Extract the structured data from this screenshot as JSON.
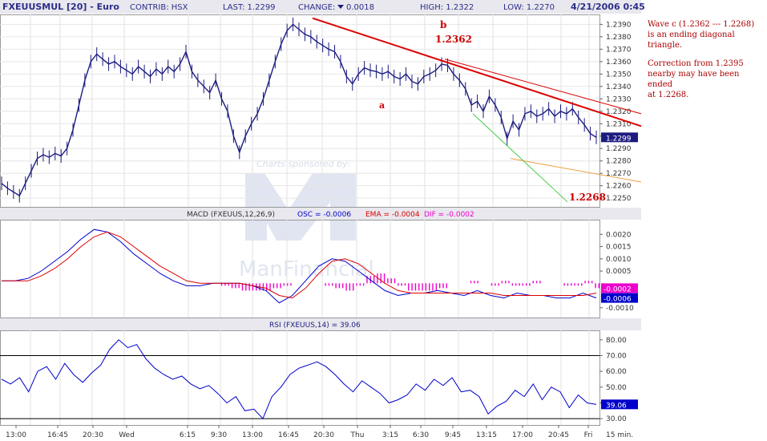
{
  "header": {
    "symbol": "FXEUUSMUL [20] - Euro",
    "contrib": "CONTRIB: HSX",
    "last": "LAST: 1.2299",
    "change_label": "CHANGE:",
    "change_value": "0.0018",
    "high": "HIGH: 1.2322",
    "low": "LOW: 1.2270",
    "datetime": "4/21/2006 0:45"
  },
  "watermark": {
    "sponsor": "Charts sponsored by:",
    "brand": "ManFinancial"
  },
  "colors": {
    "price": "#1c1c80",
    "trendline": "#dd0000",
    "channel_orange": "#f0a040",
    "channel_green": "#44cc44",
    "macd": "#0000cc",
    "signal": "#dd0000",
    "histogram": "#ee00cc",
    "rsi": "#0000cc",
    "header_bg": "#e8e8ee",
    "panel_header_bg": "#e8e8ee"
  },
  "chart_data": [
    {
      "type": "line",
      "title": "FXEUUSMUL [20] - Euro",
      "ylim": [
        1.2243,
        1.2398
      ],
      "ytick_labels": [
        "1.2390",
        "1.2380",
        "1.2370",
        "1.2360",
        "1.2350",
        "1.2340",
        "1.2330",
        "1.2320",
        "1.2310",
        "1.2300",
        "1.2290",
        "1.2280",
        "1.2270",
        "1.2260",
        "1.2250"
      ],
      "yticks": [
        1.239,
        1.238,
        1.237,
        1.236,
        1.235,
        1.234,
        1.233,
        1.232,
        1.231,
        1.23,
        1.229,
        1.228,
        1.227,
        1.226,
        1.225
      ],
      "last_value_label": "1.2299",
      "last_value": 1.2299,
      "xtick_labels": [
        "13:00",
        "16:45",
        "20:30",
        "Wed",
        "6:15",
        "9:30",
        "13:00",
        "16:45",
        "20:30",
        "Thu",
        "3:15",
        "6:30",
        "9:45",
        "13:15",
        "17:00",
        "20:45",
        "Fri"
      ],
      "xaxis_unit": "15 min.",
      "series": [
        {
          "values": [
            1.2262,
            1.2258,
            1.2255,
            1.2252,
            1.2262,
            1.2272,
            1.2282,
            1.2285,
            1.2283,
            1.2286,
            1.2284,
            1.229,
            1.2305,
            1.2325,
            1.2345,
            1.236,
            1.2366,
            1.2362,
            1.2358,
            1.236,
            1.2356,
            1.2353,
            1.235,
            1.2356,
            1.2352,
            1.2348,
            1.2354,
            1.235,
            1.2356,
            1.2352,
            1.2358,
            1.2368,
            1.2352,
            1.2345,
            1.234,
            1.2335,
            1.2345,
            1.233,
            1.232,
            1.23,
            1.2287,
            1.23,
            1.231,
            1.2318,
            1.233,
            1.2345,
            1.236,
            1.2374,
            1.2385,
            1.239,
            1.2386,
            1.2382,
            1.238,
            1.2376,
            1.2373,
            1.237,
            1.2368,
            1.236,
            1.2348,
            1.2342,
            1.235,
            1.2355,
            1.2353,
            1.2352,
            1.235,
            1.2352,
            1.2348,
            1.2346,
            1.235,
            1.2344,
            1.2342,
            1.2348,
            1.235,
            1.2353,
            1.2358,
            1.2357,
            1.235,
            1.2345,
            1.2338,
            1.2325,
            1.2328,
            1.232,
            1.2332,
            1.2325,
            1.2315,
            1.2298,
            1.2312,
            1.2305,
            1.2318,
            1.232,
            1.2316,
            1.2318,
            1.2322,
            1.2316,
            1.232,
            1.2318,
            1.2322,
            1.2315,
            1.2309,
            1.2302,
            1.2299
          ]
        }
      ],
      "annotations": [
        {
          "label": "b",
          "price_label": "1.2362"
        },
        {
          "label": "a"
        },
        {
          "label": "c",
          "price_label": "1.2268"
        }
      ]
    },
    {
      "type": "line",
      "title": "MACD",
      "legend": {
        "macd": "MACD (FXEUUS,12,26,9)",
        "osc": "OSC = -0.0006",
        "ema": "EMA = -0.0004",
        "dif": "DIF = -0.0002"
      },
      "ylim": [
        -0.0014,
        0.0026
      ],
      "ytick_labels": [
        "0.0020",
        "0.0015",
        "0.0010",
        "0.0005",
        "-0.0010"
      ],
      "yticks": [
        0.002,
        0.0015,
        0.001,
        0.0005,
        -0.001
      ],
      "last_value_labels": [
        "-0.0006",
        "-0.0002"
      ],
      "series": [
        {
          "name": "OSC",
          "values": [
            0.0001,
            0.0001,
            0.0002,
            0.0005,
            0.0009,
            0.0013,
            0.0018,
            0.0022,
            0.0021,
            0.0017,
            0.0012,
            0.0008,
            0.0004,
            0.0001,
            -0.0001,
            -0.0001,
            0,
            0,
            0,
            -0.0001,
            -0.0003,
            -0.0008,
            -0.0005,
            0.0001,
            0.0007,
            0.001,
            0.0009,
            0.0005,
            0.0001,
            -0.0003,
            -0.0005,
            -0.0004,
            -0.0004,
            -0.0003,
            -0.0004,
            -0.0005,
            -0.0003,
            -0.0005,
            -0.0006,
            -0.0004,
            -0.0005,
            -0.0005,
            -0.0006,
            -0.0006,
            -0.0004,
            -0.0006
          ]
        },
        {
          "name": "EMA",
          "values": [
            0.0001,
            0.0001,
            0.0001,
            0.0003,
            0.0006,
            0.001,
            0.0015,
            0.0019,
            0.0021,
            0.0019,
            0.0015,
            0.0011,
            0.0007,
            0.0004,
            0.0001,
            0,
            0,
            0,
            0,
            -0.0001,
            -0.0002,
            -0.0005,
            -0.0006,
            -0.0002,
            0.0004,
            0.0009,
            0.001,
            0.0008,
            0.0004,
            0,
            -0.0003,
            -0.0004,
            -0.0004,
            -0.0004,
            -0.0004,
            -0.0004,
            -0.0004,
            -0.0004,
            -0.0005,
            -0.0005,
            -0.0005,
            -0.0005,
            -0.0005,
            -0.0005,
            -0.0005,
            -0.0004
          ]
        },
        {
          "name": "DIF",
          "values": [
            0,
            0,
            0,
            0,
            0,
            0,
            0,
            0,
            0,
            -0.0001,
            -0.0002,
            -0.0003,
            -0.0003,
            -0.0003,
            -0.0002,
            -0.0001,
            0,
            0,
            0,
            -0.0001,
            -0.0002,
            -0.0003,
            -0.0001,
            0.0003,
            0.0004,
            0.0002,
            -0.0001,
            -0.0003,
            -0.0003,
            -0.0003,
            -0.0002,
            0,
            0,
            0.0001,
            0,
            -0.0001,
            0.0001,
            -0.0001,
            -0.0001,
            0.0001,
            0,
            0,
            -0.0001,
            -0.0001,
            0.0001,
            -0.0002
          ]
        }
      ]
    },
    {
      "type": "line",
      "title": "RSI (FXEUUS,14) = 39.06",
      "ylim": [
        26,
        86
      ],
      "ytick_labels": [
        "80.00",
        "70.00",
        "60.00",
        "50.00",
        "40.00",
        "30.00"
      ],
      "yticks": [
        80,
        70,
        60,
        50,
        40,
        30
      ],
      "reference_lines": [
        70,
        30
      ],
      "last_value_label": "39.06",
      "last_value": 39.06,
      "series": [
        {
          "values": [
            55,
            52,
            56,
            47,
            60,
            63,
            55,
            65,
            58,
            53,
            59,
            64,
            74,
            80,
            75,
            77,
            68,
            62,
            58,
            55,
            57,
            52,
            49,
            51,
            46,
            40,
            44,
            35,
            36,
            30,
            44,
            50,
            58,
            62,
            64,
            66,
            63,
            58,
            52,
            47,
            54,
            50,
            46,
            40,
            42,
            45,
            52,
            48,
            55,
            51,
            56,
            47,
            48,
            44,
            33,
            38,
            41,
            48,
            44,
            52,
            42,
            50,
            47,
            37,
            45,
            40,
            39
          ]
        }
      ]
    }
  ],
  "notes": {
    "p1_line1": "Wave c  (1.2362 --- 1.2268)",
    "p1_line2": "is an ending diagonal triangle.",
    "p2_line1": "Correction from 1.2395",
    "p2_line2": "nearby may have been ended",
    "p2_line3": "at 1.2268."
  }
}
